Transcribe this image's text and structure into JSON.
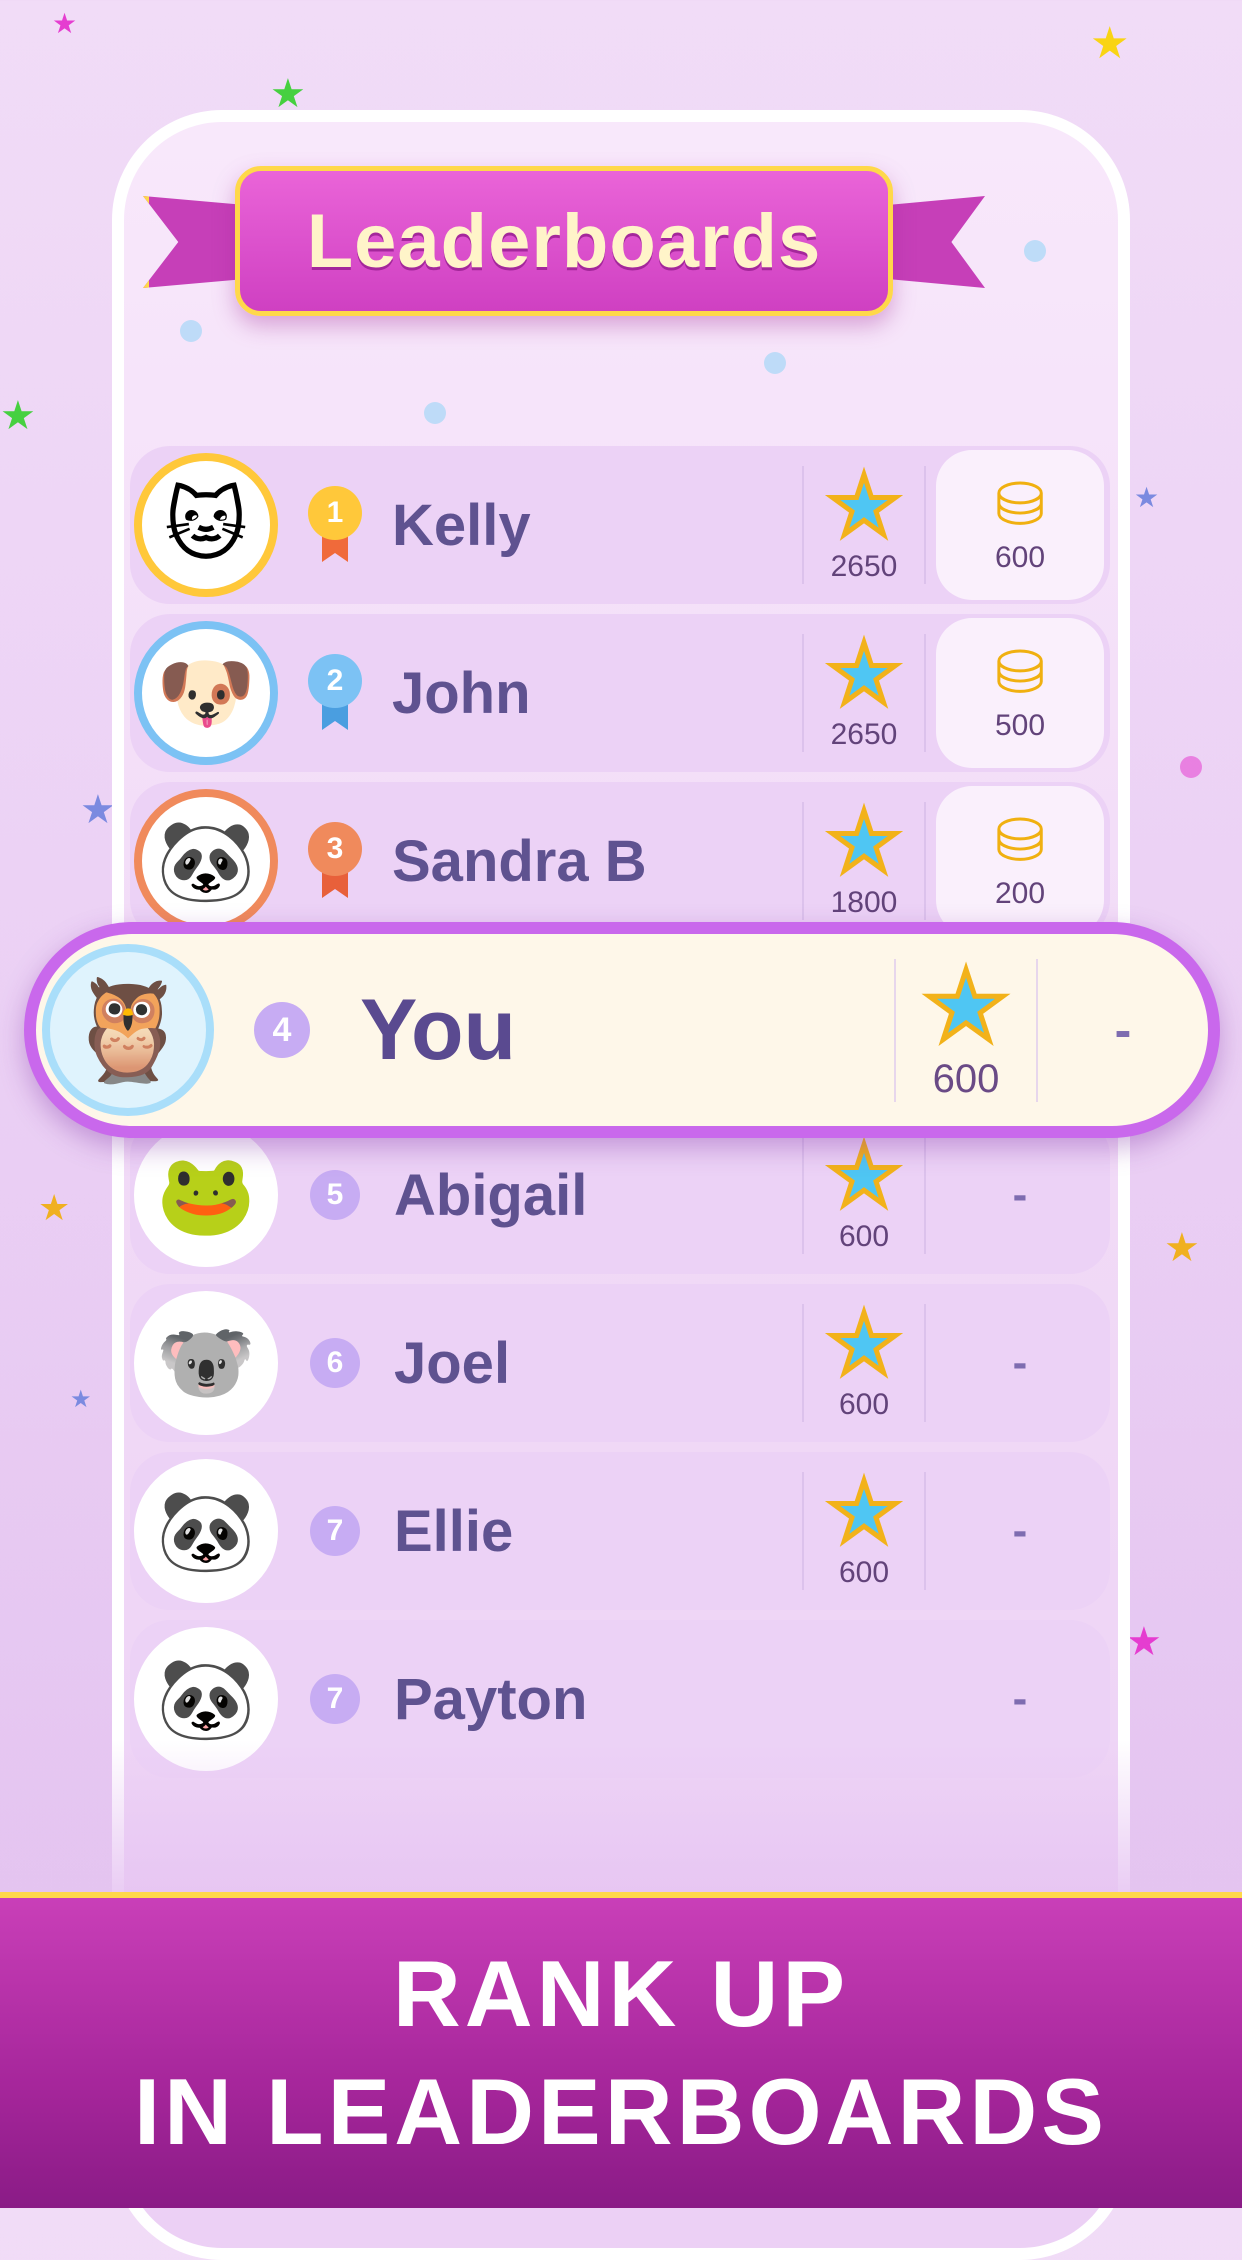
{
  "banner": {
    "title": "Leaderboards"
  },
  "leaderboard": {
    "rows": [
      {
        "rank": "1",
        "name": "Kelly",
        "stars": "2650",
        "reward": "600"
      },
      {
        "rank": "2",
        "name": "John",
        "stars": "2650",
        "reward": "500"
      },
      {
        "rank": "3",
        "name": "Sandra B",
        "stars": "1800",
        "reward": "200"
      },
      {
        "rank": "5",
        "name": "Abigail",
        "stars": "600",
        "reward": "-"
      },
      {
        "rank": "6",
        "name": "Joel",
        "stars": "600",
        "reward": "-"
      },
      {
        "rank": "7",
        "name": "Ellie",
        "stars": "600",
        "reward": "-"
      },
      {
        "rank": "7",
        "name": "Payton",
        "stars": "",
        "reward": "-"
      }
    ],
    "you": {
      "rank": "4",
      "name": "You",
      "stars": "600",
      "reward": "-"
    }
  },
  "icons": {
    "star": "★",
    "coins": "⛁",
    "cat": "🐱",
    "dog": "🐶",
    "panda": "🐼",
    "owl": "🦉",
    "frog": "🐸",
    "koala": "🐨"
  },
  "colors": {
    "gold": "#ffc83a",
    "silver_blue": "#7cc2f4",
    "bronze": "#f08a5c",
    "accent_purple": "#c968ec",
    "banner_pink": "#d94ccb"
  },
  "footer": {
    "line1": "RANK UP",
    "line2": "IN LEADERBOARDS"
  }
}
